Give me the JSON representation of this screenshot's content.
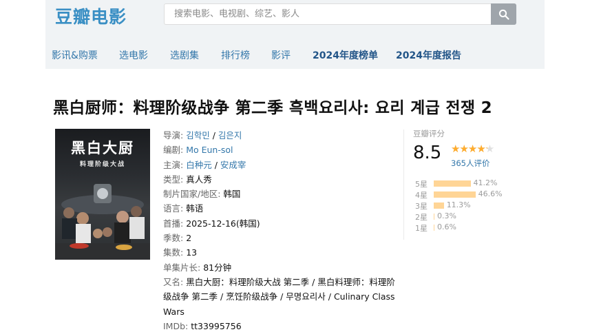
{
  "header": {
    "logo": "豆瓣电影",
    "search_placeholder": "搜索电影、电视剧、综艺、影人"
  },
  "nav": {
    "items": [
      "影讯&购票",
      "选电影",
      "选剧集",
      "排行榜",
      "影评",
      "2024年度榜单",
      "2024年度报告"
    ]
  },
  "title": "黑白厨师：料理阶级战争 第二季 흑백요리사: 요리 계급 전쟁 2",
  "poster": {
    "title": "黑白大厨",
    "subtitle": "料理阶级大战"
  },
  "info": {
    "director_label": "导演:",
    "directors": [
      "김학민",
      "김은지"
    ],
    "writer_label": "编剧:",
    "writer": "Mo Eun-sol",
    "cast_label": "主演:",
    "cast": [
      "白种元",
      "安成宰"
    ],
    "genre_label": "类型:",
    "genre": "真人秀",
    "country_label": "制片国家/地区:",
    "country": "韩国",
    "language_label": "语言:",
    "language": "韩语",
    "premiere_label": "首播:",
    "premiere": "2025-12-16(韩国)",
    "seasons_label": "季数:",
    "seasons": "2",
    "episodes_label": "集数:",
    "episodes": "13",
    "runtime_label": "单集片长:",
    "runtime": "81分钟",
    "aka_label": "又名:",
    "aka": "黑白大厨：料理阶级大战 第二季 / 黑白料理师：料理阶级战争 第二季 / 烹饪阶级战争 / 무명요리사 / Culinary Class Wars",
    "imdb_label": "IMDb:",
    "imdb": "tt33995756",
    "sep": " / "
  },
  "rating": {
    "label": "豆瓣评分",
    "score": "8.5",
    "stars": "★★★★★",
    "stars_fraction": 0.85,
    "count": "365人评价",
    "distribution": [
      {
        "label": "5星",
        "pct": "41.2%",
        "value": 41.2
      },
      {
        "label": "4星",
        "pct": "46.6%",
        "value": 46.6
      },
      {
        "label": "3星",
        "pct": "11.3%",
        "value": 11.3
      },
      {
        "label": "2星",
        "pct": "0.3%",
        "value": 0.3
      },
      {
        "label": "1星",
        "pct": "0.6%",
        "value": 0.6
      }
    ]
  },
  "colors": {
    "link": "#3377aa",
    "star": "#ffac2d",
    "bar": "#ffd596",
    "logo": "#3a8fc4"
  }
}
